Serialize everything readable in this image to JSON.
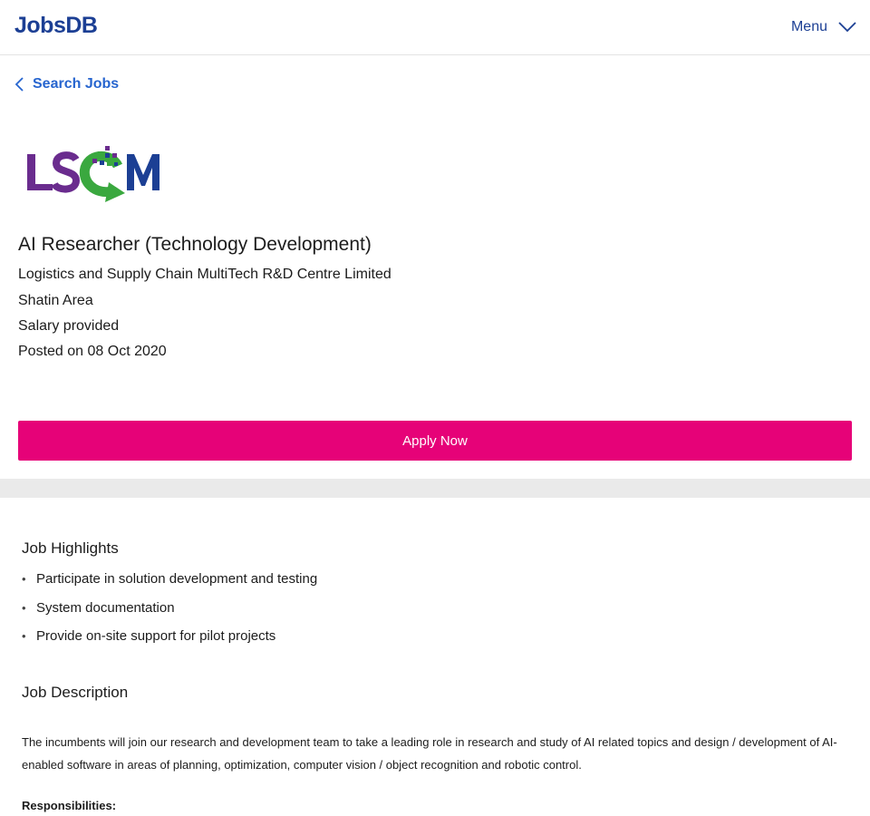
{
  "header": {
    "logo_text": "JobsDB",
    "menu_label": "Menu",
    "menu_icon": "chevron-down-icon"
  },
  "navigation": {
    "back_label": "Search Jobs",
    "back_icon": "chevron-left-icon"
  },
  "job": {
    "company_logo_text": "LSCM",
    "title": "AI Researcher (Technology Development)",
    "company": "Logistics and Supply Chain MultiTech R&D Centre Limited",
    "location": "Shatin Area",
    "salary": "Salary provided",
    "posted": "Posted on 08 Oct 2020"
  },
  "apply_button_label": "Apply Now",
  "highlights": {
    "heading": "Job Highlights",
    "items": [
      "Participate in solution development and testing",
      "System documentation",
      "Provide on-site support for pilot projects"
    ]
  },
  "description": {
    "heading": "Job Description",
    "text": "The incumbents will join our research and development team to take a leading role in research and study of AI related topics and design / development of AI-enabled software in areas of planning, optimization, computer vision / object recognition and robotic control.",
    "responsibilities_label": "Responsibilities:"
  },
  "colors": {
    "brand_blue": "#1c3f94",
    "link_blue": "#2765cf",
    "apply_pink": "#e60278",
    "logo_purple": "#6a2c8e",
    "logo_green": "#3aa83f"
  }
}
